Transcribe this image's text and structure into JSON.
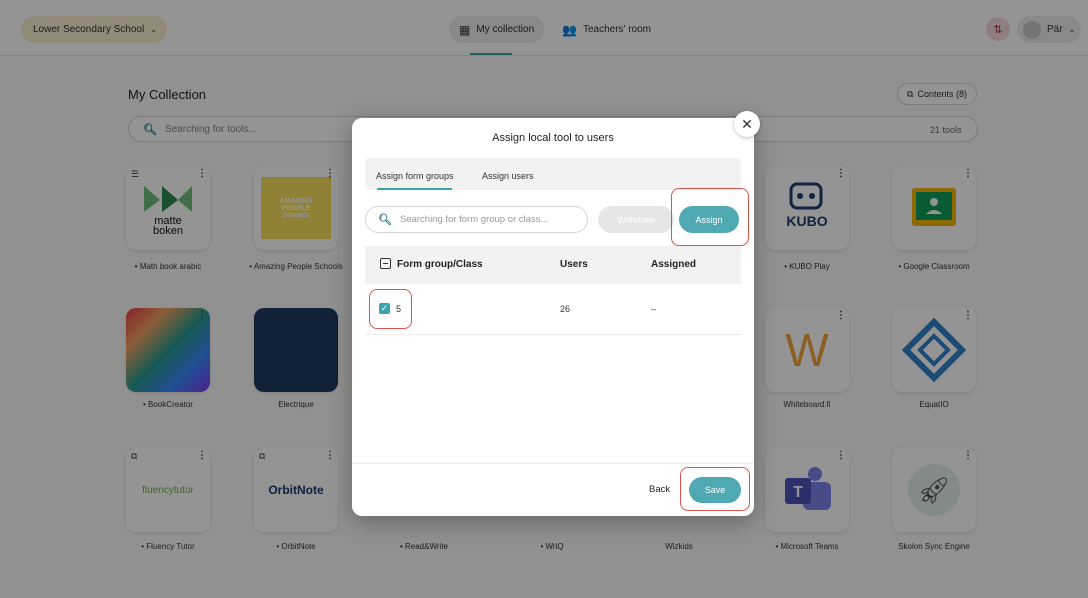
{
  "header": {
    "school": "Lower Secondary School",
    "tabs": [
      {
        "label": "My collection",
        "active": true
      },
      {
        "label": "Teachers' room",
        "active": false
      }
    ],
    "user_name": "Pär"
  },
  "collection": {
    "title": "My Collection",
    "contents_label": "Contents (8)",
    "search_placeholder": "Searching for tools...",
    "tools_count": "21 tools",
    "tiles": [
      {
        "label": "• Math book arabic",
        "logo": "matte\nboken"
      },
      {
        "label": "• Amazing People Schools",
        "logo": "AMAZING PEOPLE Schools"
      },
      {
        "label": "• KUBO Play",
        "logo": "KUBO"
      },
      {
        "label": "• Google Classroom",
        "logo": ""
      },
      {
        "label": "• BookCreator",
        "logo": ""
      },
      {
        "label": "Electrique",
        "logo": ""
      },
      {
        "label": "Whiteboard.fi",
        "logo": "W"
      },
      {
        "label": "EquatIO",
        "logo": ""
      },
      {
        "label": "• Fluency Tutor",
        "logo": "fluencytutor"
      },
      {
        "label": "• OrbitNote",
        "logo": "OrbitNote"
      },
      {
        "label": "• Read&Write",
        "logo": ""
      },
      {
        "label": "• WriQ",
        "logo": ""
      },
      {
        "label": "Wizkids",
        "logo": ""
      },
      {
        "label": "• Microsoft Teams",
        "logo": "T"
      },
      {
        "label": "Skolon Sync Engine",
        "logo": ""
      }
    ]
  },
  "modal": {
    "title": "Assign local tool to users",
    "tabs": [
      {
        "label": "Assign form groups",
        "active": true
      },
      {
        "label": "Assign users",
        "active": false
      }
    ],
    "search_placeholder": "Searching for form group or class...",
    "withdraw_label": "Withdraw",
    "assign_label": "Assign",
    "columns": [
      "Form group/Class",
      "Users",
      "Assigned"
    ],
    "rows": [
      {
        "group": "5",
        "users": "26",
        "assigned": "–",
        "checked": true
      }
    ],
    "back_label": "Back",
    "save_label": "Save"
  },
  "colors": {
    "accent": "#4fa9b3",
    "highlight": "#d9534f",
    "school_pill": "#fbeecf"
  }
}
